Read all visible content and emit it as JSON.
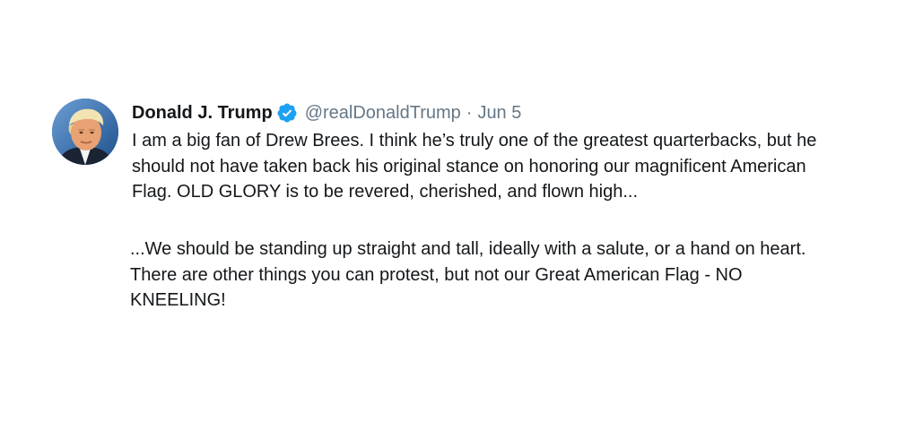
{
  "tweet": {
    "display_name": "Donald J. Trump",
    "handle": "@realDonaldTrump",
    "separator": "·",
    "date": "Jun 5",
    "verified": true,
    "avatar_icon": "profile-photo",
    "text": "I am a big fan of Drew Brees. I think he’s truly one of the greatest quarterbacks, but he should not have taken back his original stance on honoring our magnificent American Flag. OLD GLORY is to be revered, cherished, and flown high...",
    "continuation": "...We should be standing up straight and tall, ideally with a salute, or a hand on heart. There are other things you can protest, but not our Great American Flag - NO KNEELING!"
  },
  "colors": {
    "text": "#14171a",
    "muted": "#657786",
    "verified_badge": "#1da1f2",
    "background": "#ffffff"
  }
}
